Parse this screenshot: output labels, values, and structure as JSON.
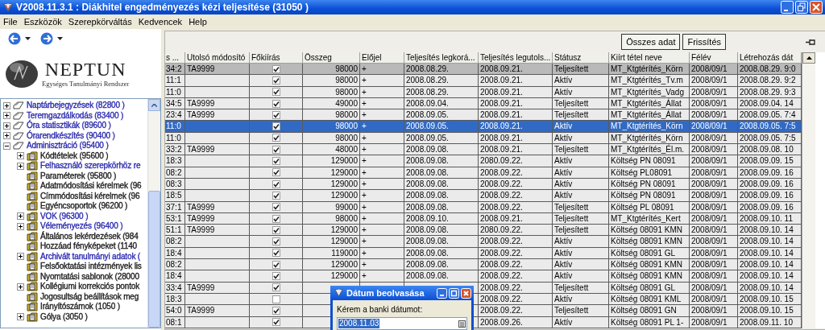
{
  "window": {
    "title": "V2008.11.3.1 : Diákhitel engedményezés kézi teljesítése (31050 )"
  },
  "menu": [
    "File",
    "Eszközök",
    "Szerepkörváltás",
    "Kedvencek",
    "Help"
  ],
  "sidebar": {
    "logo": {
      "name": "NEPTUN",
      "tagline": "Egységes Tanulmányi Rendszer"
    },
    "tree": [
      {
        "label": "Naptárbejegyzések (82800 )",
        "kind": "module",
        "expandable": true,
        "expanded": false,
        "color": "#2a2ab0"
      },
      {
        "label": "Teremgazdálkodás (83400 )",
        "kind": "module",
        "expandable": true,
        "expanded": false,
        "color": "#2a2ab0"
      },
      {
        "label": "Óra statisztikák (89600 )",
        "kind": "module",
        "expandable": true,
        "expanded": false,
        "color": "#2a2ab0"
      },
      {
        "label": "Órarendkészítés (90400 )",
        "kind": "module",
        "expandable": true,
        "expanded": false,
        "color": "#2a2ab0"
      },
      {
        "label": "Adminisztráció (95400 )",
        "kind": "module",
        "expandable": true,
        "expanded": true,
        "color": "#2a2ab0",
        "children": [
          {
            "label": "Kódtételek (95600 )",
            "kind": "folder",
            "expandable": true,
            "expanded": false,
            "color": "#202020"
          },
          {
            "label": "Felhasználó szerepkörhöz re",
            "kind": "folder",
            "expandable": true,
            "expanded": false,
            "color": "#2a2ab0"
          },
          {
            "label": "Paraméterek (95800 )",
            "kind": "folder",
            "expandable": false,
            "expanded": false,
            "color": "#202020"
          },
          {
            "label": "Adatmódosítási kérelmek (96",
            "kind": "folder",
            "expandable": false,
            "expanded": false,
            "color": "#202020"
          },
          {
            "label": "Címmódosítási kérelmek (96",
            "kind": "folder",
            "expandable": false,
            "expanded": false,
            "color": "#202020"
          },
          {
            "label": "Egyéncsoportok (96200 )",
            "kind": "folder",
            "expandable": false,
            "expanded": false,
            "color": "#202020"
          },
          {
            "label": "VOK (96300 )",
            "kind": "folder",
            "expandable": true,
            "expanded": false,
            "color": "#2a2ab0"
          },
          {
            "label": "Véleményezés (96400 )",
            "kind": "folder",
            "expandable": true,
            "expanded": false,
            "color": "#2a2ab0"
          },
          {
            "label": "Általános lekérdezések (984",
            "kind": "folder",
            "expandable": false,
            "expanded": false,
            "color": "#202020"
          },
          {
            "label": "Hozzáad fényképeket (1140",
            "kind": "folder",
            "expandable": false,
            "expanded": false,
            "color": "#202020"
          },
          {
            "label": "Archivált tanulmányi adatok (",
            "kind": "folder",
            "expandable": true,
            "expanded": false,
            "color": "#2a2ab0"
          },
          {
            "label": "Felsőoktatási intézmények lis",
            "kind": "folder",
            "expandable": false,
            "expanded": false,
            "color": "#202020"
          },
          {
            "label": "Nyomtatási sablonok (28000",
            "kind": "folder",
            "expandable": false,
            "expanded": false,
            "color": "#202020"
          },
          {
            "label": "Kollégiumi korrekciós pontok",
            "kind": "folder",
            "expandable": true,
            "expanded": false,
            "color": "#202020"
          },
          {
            "label": "Jogosultság beállítások meg",
            "kind": "folder",
            "expandable": false,
            "expanded": false,
            "color": "#202020"
          },
          {
            "label": "Irányítószámok (1050 )",
            "kind": "folder",
            "expandable": false,
            "expanded": false,
            "color": "#202020"
          },
          {
            "label": "Gólya (3050 )",
            "kind": "folder",
            "expandable": true,
            "expanded": false,
            "color": "#202020"
          }
        ]
      }
    ]
  },
  "toolbar": {
    "buttons": [
      "Összes adat",
      "Frissítés"
    ]
  },
  "table": {
    "columns": [
      {
        "label": "s ...",
        "kind": "text"
      },
      {
        "label": "Utolsó módosító",
        "kind": "text"
      },
      {
        "label": "Főkiírás",
        "kind": "check"
      },
      {
        "label": "Összeg",
        "kind": "number"
      },
      {
        "label": "Előjel",
        "kind": "text"
      },
      {
        "label": "Teljesítés legkorá...",
        "kind": "text"
      },
      {
        "label": "Teljesítés legutols...",
        "kind": "text"
      },
      {
        "label": "Státusz",
        "kind": "text"
      },
      {
        "label": "Kiírt tétel neve",
        "kind": "text"
      },
      {
        "label": "Félév",
        "kind": "text"
      },
      {
        "label": "Létrehozás dát",
        "kind": "text"
      }
    ],
    "rows": [
      {
        "selected": false,
        "focused": true,
        "cells": [
          "34:2",
          "TA9999",
          true,
          "98000",
          "+",
          "2008.08.29.",
          "2008.09.21.",
          "Teljesített",
          "MT_Ktgtérítés_Körn",
          "2008/09/1",
          "2008.08.29. 9:0"
        ]
      },
      {
        "selected": false,
        "focused": false,
        "cells": [
          "11:1",
          null,
          true,
          "98000",
          "+",
          "2008.08.29.",
          "2008.09.21.",
          "Aktív",
          "MT_Ktgtérítés_Tv.m",
          "2008/09/1",
          "2008.08.29. 9:2"
        ]
      },
      {
        "selected": false,
        "focused": false,
        "cells": [
          "11:0",
          null,
          true,
          "98000",
          "+",
          "2008.08.29.",
          "2008.09.21.",
          "Aktív",
          "MT_Ktgtérítés_Vadg",
          "2008/09/1",
          "2008.08.29. 9:3"
        ]
      },
      {
        "selected": false,
        "focused": false,
        "cells": [
          "34:5",
          "TA9999",
          true,
          "49000",
          "+",
          "2008.09.04.",
          "2008.09.21.",
          "Teljesített",
          "MT_Ktgtérítés_Állat",
          "2008/09/1",
          "2008.09.04. 14"
        ]
      },
      {
        "selected": false,
        "focused": false,
        "cells": [
          "23:4",
          "TA9999",
          true,
          "98000",
          "+",
          "2008.09.05.",
          "2008.09.21.",
          "Teljesített",
          "MT_Ktgtérítés_Állat",
          "2008/09/1",
          "2008.09.05. 7:4"
        ]
      },
      {
        "selected": true,
        "focused": false,
        "cells": [
          "11:0",
          null,
          true,
          "98000",
          "+",
          "2008.09.05.",
          "2008.09.21.",
          "Aktív",
          "MT_Ktgtérítés_Körn",
          "2008/09/1",
          "2008.09.05. 7:5"
        ]
      },
      {
        "selected": false,
        "focused": false,
        "cells": [
          "11:0",
          null,
          true,
          "98000",
          "+",
          "2008.09.05.",
          "2008.09.21.",
          "Aktív",
          "MT_Ktgtérítés_Körn",
          "2008/09/1",
          "2008.09.05. 7:5"
        ]
      },
      {
        "selected": false,
        "focused": false,
        "cells": [
          "33:2",
          "TA9999",
          true,
          "48000",
          "+",
          "2008.09.08.",
          "2008.09.21.",
          "Teljesített",
          "MT_Ktgtérítés_Él.m.",
          "2008/09/1",
          "2008.09.08. 10"
        ]
      },
      {
        "selected": false,
        "focused": false,
        "cells": [
          "18:3",
          null,
          true,
          "129000",
          "+",
          "2008.09.08.",
          "2080.09.22.",
          "Aktív",
          "Költség PN 08091",
          "2008/09/1",
          "2008.09.09. 15"
        ]
      },
      {
        "selected": false,
        "focused": false,
        "cells": [
          "08:2",
          null,
          true,
          "129000",
          "+",
          "2008.09.08.",
          "2008.09.22.",
          "Aktív",
          "Költség PL08091",
          "2008/09/1",
          "2008.09.09. 16"
        ]
      },
      {
        "selected": false,
        "focused": false,
        "cells": [
          "08:3",
          null,
          true,
          "129000",
          "+",
          "2008.09.08.",
          "2008.09.22.",
          "Aktív",
          "Költség PN 08091",
          "2008/09/1",
          "2008.09.09. 16"
        ]
      },
      {
        "selected": false,
        "focused": false,
        "cells": [
          "18:5",
          null,
          true,
          "129000",
          "+",
          "2008.09.08.",
          "2008.09.22.",
          "Aktív",
          "Költség PN 08091",
          "2008/09/1",
          "2008.09.09. 16"
        ]
      },
      {
        "selected": false,
        "focused": false,
        "cells": [
          "37:1",
          "TA9999",
          true,
          "99000",
          "+",
          "2008.09.08.",
          "2008.09.22.",
          "Teljesített",
          "Költség PL 08091",
          "2008/09/1",
          "2008.09.09. 16"
        ]
      },
      {
        "selected": false,
        "focused": false,
        "cells": [
          "53:1",
          "TA9999",
          true,
          "98000",
          "+",
          "2008.09.10.",
          "2008.09.21.",
          "Teljesített",
          "MT_Ktgtérítés_Kert",
          "2008/09/1",
          "2008.09.10. 11"
        ]
      },
      {
        "selected": false,
        "focused": false,
        "cells": [
          "51:1",
          "TA9999",
          true,
          "129000",
          "+",
          "2008.09.08.",
          "2080.09.22.",
          "Teljesített",
          "Költség 08091 KMN",
          "2008/09/1",
          "2008.09.10. 14"
        ]
      },
      {
        "selected": false,
        "focused": false,
        "cells": [
          "08:2",
          null,
          true,
          "129000",
          "+",
          "2008.09.08.",
          "2008.09.22.",
          "Aktív",
          "Költség 08091 KMN",
          "2008/09/1",
          "2008.09.10. 14"
        ]
      },
      {
        "selected": false,
        "focused": false,
        "cells": [
          "18:4",
          null,
          true,
          "119000",
          "+",
          "2008.09.08.",
          "2008.09.22.",
          "Aktív",
          "Költség 08091 GL",
          "2008/09/1",
          "2008.09.10. 14"
        ]
      },
      {
        "selected": false,
        "focused": false,
        "cells": [
          "08:2",
          null,
          true,
          "129000",
          "+",
          "2008.09.08.",
          "2008.09.22.",
          "Aktív",
          "Költség 08091 KMN",
          "2008/09/1",
          "2008.09.10. 14"
        ]
      },
      {
        "selected": false,
        "focused": false,
        "cells": [
          "18:4",
          null,
          true,
          "129000",
          "+",
          "2008.09.08.",
          "2008.09.22.",
          "Aktív",
          "Költség 08091 KMN",
          "2008/09/1",
          "2008.09.10. 14"
        ]
      },
      {
        "selected": false,
        "focused": false,
        "cells": [
          "33:4",
          "TA9999",
          true,
          null,
          null,
          null,
          "2008.09.22.",
          "Teljesített",
          "Költség 08091 GL",
          "2008/09/1",
          "2008.09.10. 14"
        ]
      },
      {
        "selected": false,
        "focused": false,
        "cells": [
          "18:3",
          null,
          false,
          null,
          null,
          null,
          "2008.09.22.",
          "Aktív",
          "Költség 08091 KML",
          "2008/09/1",
          "2008.09.10. 15"
        ]
      },
      {
        "selected": false,
        "focused": false,
        "cells": [
          "54:0",
          "TA9999",
          true,
          null,
          null,
          null,
          "2008.09.22.",
          "Teljesített",
          "Költség 08091 GN",
          "2008/09/1",
          "2008.09.10. 15"
        ]
      },
      {
        "selected": false,
        "focused": false,
        "cells": [
          "08:1",
          null,
          true,
          null,
          null,
          null,
          "2008.09.26.",
          "Aktív",
          "Költség 08091 PL 1-",
          "2008/09/1",
          "2008.09.11. 10"
        ]
      }
    ]
  },
  "dialog": {
    "title": "Dátum beolvasása",
    "prompt": "Kérem a banki dátumot:",
    "value": "2008.11.03"
  }
}
